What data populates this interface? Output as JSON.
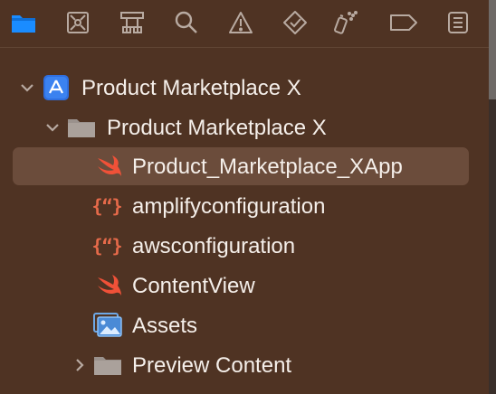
{
  "toolbar": {
    "buttons": [
      {
        "name": "project-navigator-icon",
        "active": true
      },
      {
        "name": "source-control-navigator-icon"
      },
      {
        "name": "symbol-navigator-icon"
      },
      {
        "name": "find-navigator-icon"
      },
      {
        "name": "issue-navigator-icon"
      },
      {
        "name": "test-navigator-icon"
      },
      {
        "name": "debug-navigator-icon"
      },
      {
        "name": "breakpoint-navigator-icon"
      },
      {
        "name": "report-navigator-icon"
      }
    ],
    "accent": "#1a8cff",
    "icon_color": "#b8aaa1"
  },
  "tree": {
    "project": {
      "label": "Product Marketplace X",
      "icon": "xcode-project-icon",
      "expanded": true
    },
    "group": {
      "label": "Product Marketplace X",
      "icon": "folder-icon",
      "expanded": true
    },
    "files": [
      {
        "label": "Product_Marketplace_XApp",
        "icon": "swift-icon",
        "selected": true
      },
      {
        "label": "amplifyconfiguration",
        "icon": "json-icon"
      },
      {
        "label": "awsconfiguration",
        "icon": "json-icon"
      },
      {
        "label": "ContentView",
        "icon": "swift-icon"
      },
      {
        "label": "Assets",
        "icon": "asset-catalog-icon"
      }
    ],
    "collapsed_group": {
      "label": "Preview Content",
      "icon": "folder-icon",
      "expanded": false
    },
    "json_glyph": "{“}"
  },
  "colors": {
    "background": "#4f3323",
    "selection": "#6b4c3b",
    "swift": "#f05138",
    "json": "#e66a4a",
    "folder": "#9a918c"
  }
}
